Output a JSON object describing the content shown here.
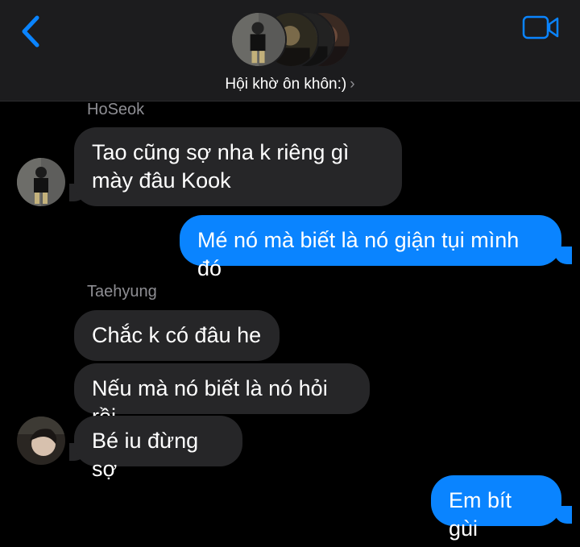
{
  "header": {
    "group_name": "Hội khờ ôn khôn:)",
    "chevron": "›",
    "back_icon": "chevron-left-icon",
    "video_icon": "video-camera-icon",
    "accent": "#0a84ff"
  },
  "messages": [
    {
      "sender": "HoSeok",
      "text": "Tao cũng sợ nha k riêng gì mày đâu Kook",
      "line1": "Tao cũng sợ nha k riêng gì",
      "line2": "mày đâu Kook",
      "direction": "incoming"
    },
    {
      "text": "Mé nó mà biết là nó giận tụi mình đó",
      "direction": "outgoing"
    },
    {
      "sender": "Taehyung",
      "text": "Chắc k có đâu he",
      "direction": "incoming"
    },
    {
      "text": "Nếu mà nó biết là nó hỏi rồi",
      "direction": "incoming"
    },
    {
      "text": "Bé iu đừng sợ",
      "direction": "incoming"
    },
    {
      "text": "Em bít gùi",
      "direction": "outgoing"
    }
  ],
  "colors": {
    "incoming_bubble": "#262628",
    "outgoing_bubble": "#0a84ff",
    "sender_label": "#8e8e93",
    "header_bg": "#1c1c1e"
  }
}
